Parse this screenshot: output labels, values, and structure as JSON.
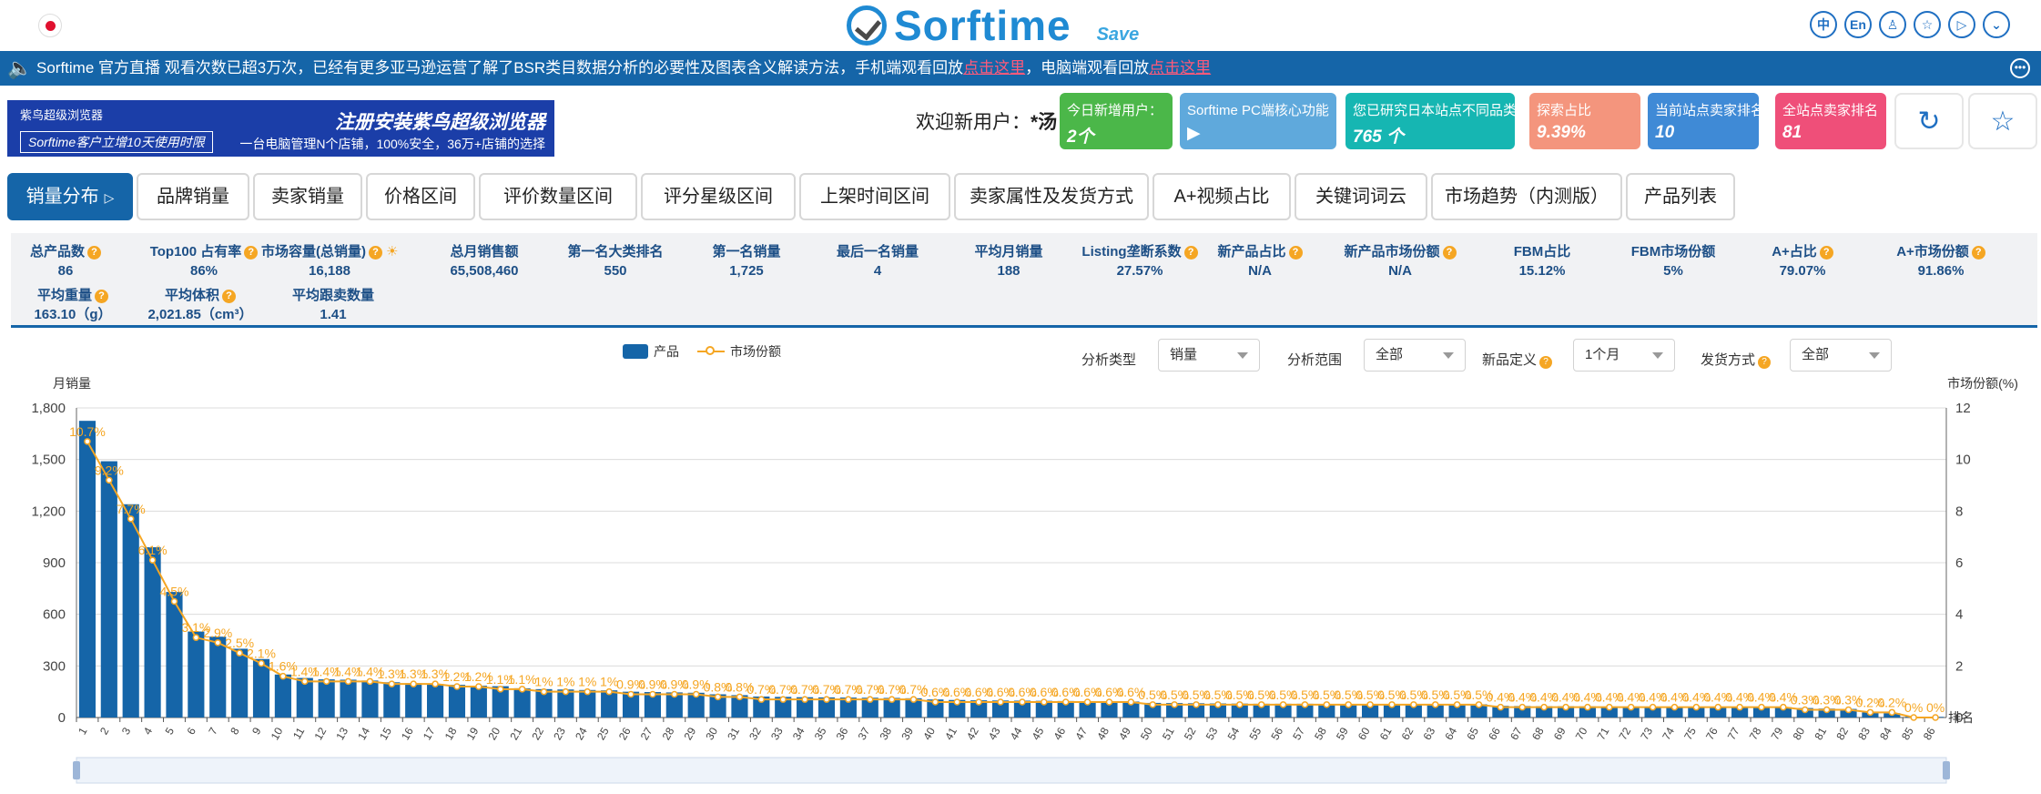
{
  "header": {
    "logo_text": "Sorftime",
    "save_text": "Save",
    "icons": [
      {
        "name": "chinese-lang-icon",
        "glyph": "中"
      },
      {
        "name": "english-lang-icon",
        "glyph": "En"
      },
      {
        "name": "user-icon",
        "glyph": "♙"
      },
      {
        "name": "star-icon",
        "glyph": "☆"
      },
      {
        "name": "video-icon",
        "glyph": "▷"
      },
      {
        "name": "chevron-down-icon",
        "glyph": "⌄"
      }
    ]
  },
  "notice": {
    "text_before": "Sorftime 官方直播 观看次数已超3万次，已经有更多亚马逊运营了解了BSR类目数据分析的必要性及图表含义解读方法，手机端观看回放",
    "link1": "点击这里",
    "text_mid": "，电脑端观看回放",
    "link2": "点击这里"
  },
  "banner": {
    "brand": "紫鸟超级浏览器",
    "tag": "Sorftime客户立增10天使用时限",
    "headline": "注册安装紫鸟超级浏览器",
    "sub": "一台电脑管理N个店铺，100%安全，36万+店铺的选择"
  },
  "welcome": {
    "label": "欢迎新用户：",
    "name": "*汤"
  },
  "stat_cards": [
    {
      "label": "今日新增用户：",
      "value": "2个",
      "color": "#4bb749"
    },
    {
      "label": "Sorftime PC端核心功能",
      "value": "▶",
      "color": "#5fa9dc"
    },
    {
      "label": "您已研究日本站点不同品类",
      "value": "765 个",
      "color": "#16b6b2"
    },
    {
      "label": "探索占比",
      "value": "9.39%",
      "color": "#f4957d"
    },
    {
      "label": "当前站点卖家排名",
      "value": "10",
      "color": "#3f8ad6"
    },
    {
      "label": "全站点卖家排名",
      "value": "81",
      "color": "#ef4f79"
    }
  ],
  "tabs": [
    "销量分布",
    "品牌销量",
    "卖家销量",
    "价格区间",
    "评价数量区间",
    "评分星级区间",
    "上架时间区间",
    "卖家属性及发货方式",
    "A+视频占比",
    "关键词词云",
    "市场趋势（内测版）",
    "产品列表"
  ],
  "stats_row1": [
    {
      "label": "总产品数",
      "value": "86",
      "q": true
    },
    {
      "label": "Top100 占有率",
      "value": "86%",
      "q": true
    },
    {
      "label": "市场容量(总销量)",
      "value": "16,188",
      "q": true
    },
    {
      "label": "总月销售额",
      "value": "65,508,460",
      "q": false
    },
    {
      "label": "第一名大类排名",
      "value": "550",
      "q": false
    },
    {
      "label": "第一名销量",
      "value": "1,725",
      "q": false
    },
    {
      "label": "最后一名销量",
      "value": "4",
      "q": false
    },
    {
      "label": "平均月销量",
      "value": "188",
      "q": false
    },
    {
      "label": "Listing垄断系数",
      "value": "27.57%",
      "q": true
    },
    {
      "label": "新产品占比",
      "value": "N/A",
      "q": true
    },
    {
      "label": "新产品市场份额",
      "value": "N/A",
      "q": true
    },
    {
      "label": "FBM占比",
      "value": "15.12%",
      "q": false
    },
    {
      "label": "FBM市场份额",
      "value": "5%",
      "q": false
    },
    {
      "label": "A+占比",
      "value": "79.07%",
      "q": true
    },
    {
      "label": "A+市场份额",
      "value": "91.86%",
      "q": true
    }
  ],
  "stats_row2": [
    {
      "label": "平均重量",
      "value": "163.10（g）",
      "q": true
    },
    {
      "label": "平均体积",
      "value": "2,021.85（cm³）",
      "q": true
    },
    {
      "label": "平均跟卖数量",
      "value": "1.41",
      "q": false
    }
  ],
  "filters": [
    {
      "label": "分析类型",
      "value": "销量",
      "q": false
    },
    {
      "label": "分析范围",
      "value": "全部",
      "q": false
    },
    {
      "label": "新品定义",
      "value": "1个月",
      "q": true
    },
    {
      "label": "发货方式",
      "value": "全部",
      "q": true
    }
  ],
  "colors": {
    "bar": "#1565a8",
    "line": "#f5a623",
    "accent": "#1565a8"
  },
  "chart_data": {
    "type": "bar",
    "legend": [
      "产品",
      "市场份额"
    ],
    "ylabel_left": "月销量",
    "ylabel_right": "市场份额(%)",
    "xlabel": "排名",
    "ylim_left": [
      0,
      1800
    ],
    "ylim_right": [
      0,
      12
    ],
    "yticks_left": [
      "0",
      "300",
      "600",
      "900",
      "1,200",
      "1,500",
      "1,800"
    ],
    "yticks_right": [
      "0",
      "2",
      "4",
      "6",
      "8",
      "10",
      "12"
    ],
    "categories": [
      "1",
      "2",
      "3",
      "4",
      "5",
      "6",
      "7",
      "8",
      "9",
      "10",
      "11",
      "12",
      "13",
      "14",
      "15",
      "16",
      "17",
      "18",
      "19",
      "20",
      "21",
      "22",
      "23",
      "24",
      "25",
      "26",
      "27",
      "28",
      "29",
      "30",
      "31",
      "32",
      "33",
      "34",
      "35",
      "36",
      "37",
      "38",
      "39",
      "40",
      "41",
      "42",
      "43",
      "44",
      "45",
      "46",
      "47",
      "48",
      "49",
      "50",
      "51",
      "52",
      "53",
      "54",
      "55",
      "56",
      "57",
      "58",
      "59",
      "60",
      "61",
      "62",
      "63",
      "64",
      "65",
      "66",
      "67",
      "68",
      "69",
      "70",
      "71",
      "72",
      "73",
      "74",
      "75",
      "76",
      "77",
      "78",
      "79",
      "80",
      "81",
      "82",
      "83",
      "84",
      "85",
      "86"
    ],
    "series": [
      {
        "name": "产品",
        "values": [
          1725,
          1490,
          1240,
          990,
          730,
          500,
          470,
          400,
          340,
          250,
          230,
          222,
          220,
          215,
          205,
          200,
          195,
          190,
          185,
          182,
          170,
          165,
          163,
          160,
          158,
          150,
          148,
          146,
          144,
          135,
          130,
          122,
          120,
          118,
          117,
          116,
          115,
          114,
          112,
          105,
          102,
          100,
          99,
          98,
          97,
          96,
          95,
          94,
          93,
          85,
          84,
          83,
          82,
          81,
          80,
          80,
          80,
          79,
          79,
          78,
          78,
          78,
          77,
          77,
          77,
          68,
          67,
          66,
          66,
          65,
          64,
          64,
          63,
          63,
          62,
          62,
          61,
          61,
          60,
          55,
          52,
          50,
          30,
          25,
          5,
          4
        ]
      },
      {
        "name": "市场份额",
        "values": [
          10.7,
          9.2,
          7.7,
          6.1,
          4.5,
          3.1,
          2.9,
          2.5,
          2.1,
          1.6,
          1.4,
          1.4,
          1.4,
          1.4,
          1.3,
          1.3,
          1.3,
          1.2,
          1.2,
          1.1,
          1.1,
          1,
          1,
          1,
          1,
          0.9,
          0.9,
          0.9,
          0.9,
          0.8,
          0.8,
          0.7,
          0.7,
          0.7,
          0.7,
          0.7,
          0.7,
          0.7,
          0.7,
          0.6,
          0.6,
          0.6,
          0.6,
          0.6,
          0.6,
          0.6,
          0.6,
          0.6,
          0.6,
          0.5,
          0.5,
          0.5,
          0.5,
          0.5,
          0.5,
          0.5,
          0.5,
          0.5,
          0.5,
          0.5,
          0.5,
          0.5,
          0.5,
          0.5,
          0.5,
          0.4,
          0.4,
          0.4,
          0.4,
          0.4,
          0.4,
          0.4,
          0.4,
          0.4,
          0.4,
          0.4,
          0.4,
          0.4,
          0.4,
          0.3,
          0.3,
          0.3,
          0.2,
          0.2,
          0,
          0
        ]
      }
    ],
    "data_labels": [
      "10.7%",
      "9.2%",
      "7.7%",
      "6.1%",
      "4.5%",
      "3.1%",
      "2.9%",
      "2.5%",
      "2.1%",
      "1.6%",
      "1.4%",
      "1.4%",
      "1.4%",
      "1.4%",
      "1.3%",
      "1.3%",
      "1.3%",
      "1.2%",
      "1.2%",
      "1.1%",
      "1.1%",
      "1%",
      "1%",
      "1%",
      "1%",
      "0.9%",
      "0.9%",
      "0.9%",
      "0.9%",
      "0.8%",
      "0.8%",
      "0.7%",
      "0.7%",
      "0.7%",
      "0.7%",
      "0.7%",
      "0.7%",
      "0.7%",
      "0.7%",
      "0.6%",
      "0.6%",
      "0.6%",
      "0.6%",
      "0.6%",
      "0.6%",
      "0.6%",
      "0.6%",
      "0.6%",
      "0.6%",
      "0.5%",
      "0.5%",
      "0.5%",
      "0.5%",
      "0.5%",
      "0.5%",
      "0.5%",
      "0.5%",
      "0.5%",
      "0.5%",
      "0.5%",
      "0.5%",
      "0.5%",
      "0.5%",
      "0.5%",
      "0.5%",
      "0.4%",
      "0.4%",
      "0.4%",
      "0.4%",
      "0.4%",
      "0.4%",
      "0.4%",
      "0.4%",
      "0.4%",
      "0.4%",
      "0.4%",
      "0.4%",
      "0.4%",
      "0.4%",
      "0.3%",
      "0.3%",
      "0.3%",
      "0.2%",
      "0.2%",
      "0%",
      "0%"
    ],
    "grid": true,
    "legend_position": "top-center"
  }
}
